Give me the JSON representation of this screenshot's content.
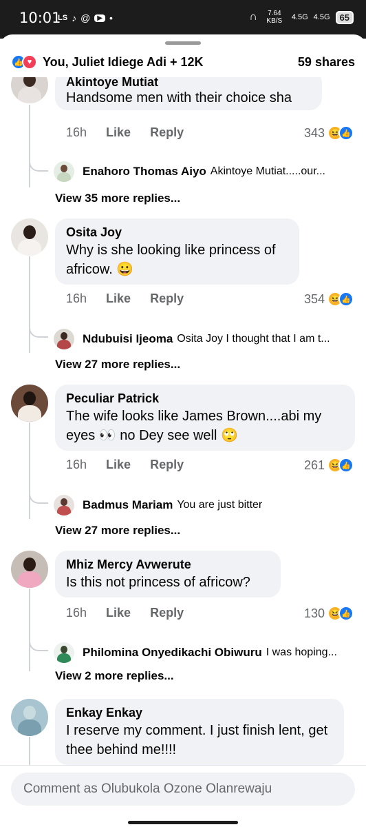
{
  "status_bar": {
    "time": "10:01",
    "left_icons": [
      "LS",
      "tiktok-icon",
      "threads-icon",
      "youtube-icon",
      "•"
    ],
    "network_speed": "7.64 KB/S",
    "signal_1": "4.5G",
    "signal_2": "4.5G",
    "battery": "65"
  },
  "header": {
    "reactors": "You, Juliet Idiege Adi + 12K",
    "shares": "59 shares"
  },
  "comments": [
    {
      "author": "Akintoye Mutiat",
      "text": "Handsome men with their choice sha",
      "time": "16h",
      "like_label": "Like",
      "reply_label": "Reply",
      "reaction_count": "343",
      "reply_preview": {
        "author": "Enahoro Thomas Aiyo",
        "text": "Akintoye Mutiat.....our..."
      },
      "view_more": "View 35 more replies..."
    },
    {
      "author": "Osita Joy",
      "text": "Why is she looking like princess of africow. 😀",
      "time": "16h",
      "like_label": "Like",
      "reply_label": "Reply",
      "reaction_count": "354",
      "reply_preview": {
        "author": "Ndubuisi Ijeoma",
        "text": "Osita Joy I thought that I am t..."
      },
      "view_more": "View 27 more replies..."
    },
    {
      "author": "Peculiar Patrick",
      "text": "The wife looks like James Brown....abi my eyes 👀 no Dey see well 🙄",
      "time": "16h",
      "like_label": "Like",
      "reply_label": "Reply",
      "reaction_count": "261",
      "reply_preview": {
        "author": "Badmus Mariam",
        "text": "You are just bitter"
      },
      "view_more": "View 27 more replies..."
    },
    {
      "author": "Mhiz Mercy Avwerute",
      "text": "Is this not princess of africow?",
      "time": "16h",
      "like_label": "Like",
      "reply_label": "Reply",
      "reaction_count": "130",
      "reply_preview": {
        "author": "Philomina Onyedikachi Obiwuru",
        "text": "I was hoping..."
      },
      "view_more": "View 2 more replies..."
    },
    {
      "author": "Enkay Enkay",
      "text": "I reserve my comment. I just finish lent, get thee behind me!!!!"
    }
  ],
  "composer": {
    "placeholder": "Comment as Olubukola Ozone Olanrewaju"
  }
}
